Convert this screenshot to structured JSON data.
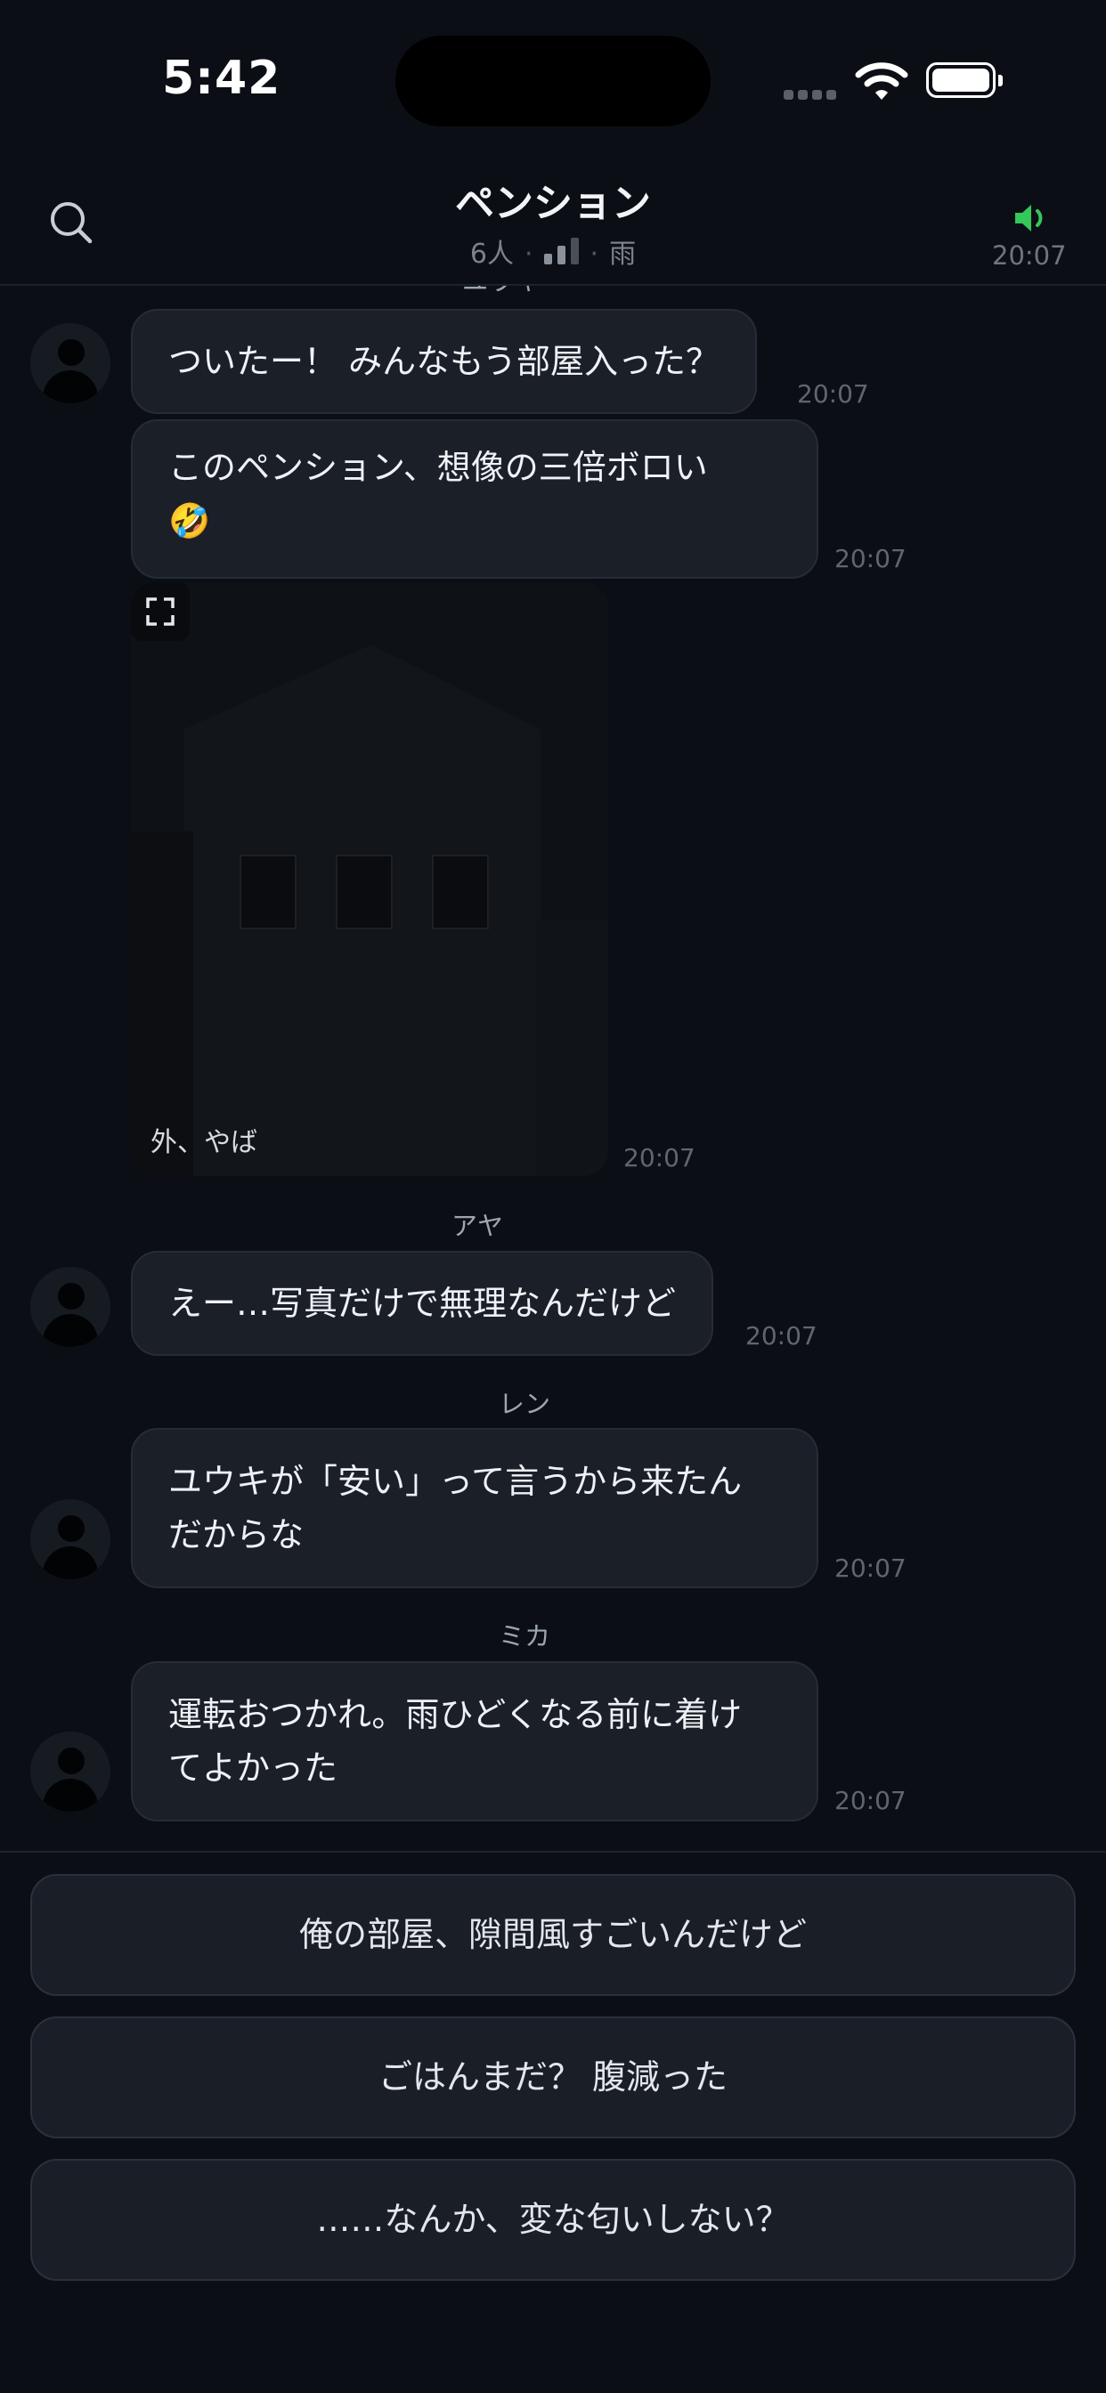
{
  "status_bar": {
    "time": "5:42"
  },
  "header": {
    "title": "ペンション",
    "member_count": "6人",
    "separator": "·",
    "weather": "雨",
    "time": "20:07",
    "sound_color": "#34c759"
  },
  "messages": {
    "cut_sender": "ユウキ",
    "m1": {
      "text": "ついたー！ みんなもう部屋入った？",
      "time": "20:07"
    },
    "m2": {
      "text_line1": "このペンション、想像の三倍ボロい",
      "emoji": "🤣",
      "time": "20:07"
    },
    "m3": {
      "caption": "外、やば",
      "time": "20:07"
    },
    "m4": {
      "sender": "アヤ",
      "text": "えー…写真だけで無理なんだけど",
      "time": "20:07"
    },
    "m5": {
      "sender": "レン",
      "text_line1": "ユウキが「安い」って言うから来たん",
      "text_line2": "だからな",
      "time": "20:07"
    },
    "m6": {
      "sender": "ミカ",
      "text_line1": "運転おつかれ。雨ひどくなる前に着け",
      "text_line2": "てよかった",
      "time": "20:07"
    }
  },
  "choices": [
    {
      "label": "俺の部屋、隙間風すごいんだけど"
    },
    {
      "label": "ごはんまだ？ 腹減った"
    },
    {
      "label": "……なんか、変な匂いしない？"
    }
  ]
}
